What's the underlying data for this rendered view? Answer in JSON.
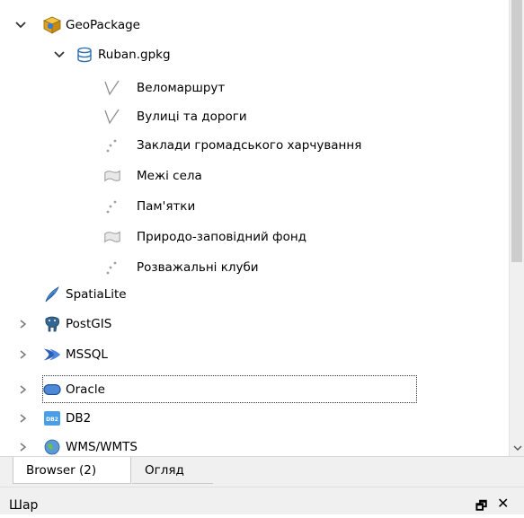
{
  "browser_tree": {
    "nodes": [
      {
        "label": "GeoPackage",
        "icon": "geopackage-icon",
        "arrow": "expanded"
      },
      {
        "label": "Ruban.gpkg",
        "icon": "database-icon",
        "arrow": "expanded"
      },
      {
        "label": "Веломаршрут",
        "icon": "line-layer-icon"
      },
      {
        "label": "Вулиці та дороги",
        "icon": "line-layer-icon"
      },
      {
        "label": "Заклади громадського харчування",
        "icon": "point-layer-icon"
      },
      {
        "label": "Межі села",
        "icon": "polygon-layer-icon"
      },
      {
        "label": "Пам'ятки",
        "icon": "point-layer-icon"
      },
      {
        "label": "Природо-заповідний фонд",
        "icon": "polygon-layer-icon"
      },
      {
        "label": "Розважальні клуби",
        "icon": "point-layer-icon"
      },
      {
        "label": "SpatiaLite",
        "icon": "feather-icon"
      },
      {
        "label": "PostGIS",
        "icon": "elephant-icon",
        "arrow": "collapsed"
      },
      {
        "label": "MSSQL",
        "icon": "mssql-icon",
        "arrow": "collapsed"
      },
      {
        "label": "Oracle",
        "icon": "oracle-icon",
        "arrow": "collapsed"
      },
      {
        "label": "DB2",
        "icon": "db2-icon",
        "arrow": "collapsed"
      },
      {
        "label": "WMS/WMTS",
        "icon": "globe-icon",
        "arrow": "collapsed"
      }
    ]
  },
  "db2_icon_text": "DB2",
  "tabs": [
    {
      "label": "Browser (2)",
      "active": true
    },
    {
      "label": "Огляд",
      "active": false
    }
  ],
  "dock": {
    "title": "Шар"
  },
  "colors": {
    "accent_blue": "#2f6fb3",
    "layer_gray": "#8f8f8f"
  }
}
